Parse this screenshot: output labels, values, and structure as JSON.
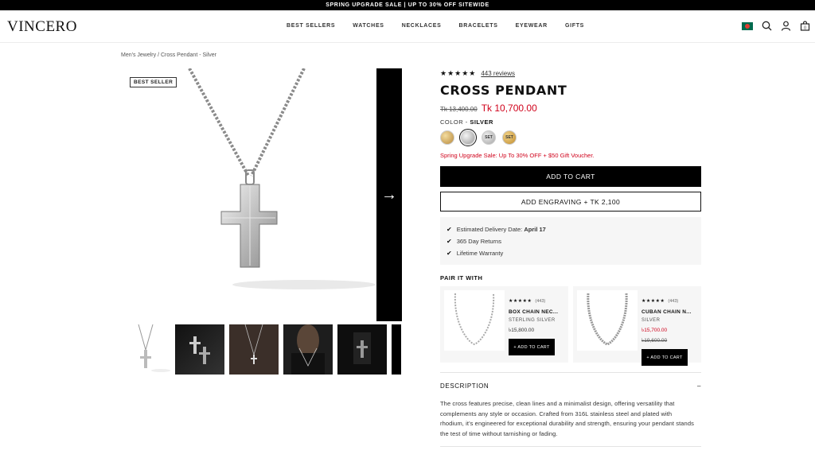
{
  "promo": {
    "text": "SPRING UPGRADE SALE | UP TO 30% OFF SITEWIDE"
  },
  "header": {
    "logo": "VINCERO",
    "nav": [
      "BEST SELLERS",
      "WATCHES",
      "NECKLACES",
      "BRACELETS",
      "EYEWEAR",
      "GIFTS"
    ],
    "icons": [
      "flag-icon",
      "search-icon",
      "account-icon",
      "cart-icon"
    ],
    "cart_count": "0"
  },
  "breadcrumb": "Men's Jewelry / Cross Pendant - Silver",
  "gallery": {
    "badge": "BEST SELLER",
    "next_arrow": "→"
  },
  "product": {
    "stars": "★★★★★",
    "reviews": "443 reviews",
    "title": "CROSS PENDANT",
    "old_price": "Tk 13,400.00",
    "new_price": "Tk 10,700.00",
    "color_label": "COLOR - ",
    "color_value": "SILVER",
    "swatches": [
      "",
      "",
      "SET",
      "SET"
    ],
    "sale_note": "Spring Upgrade Sale: Up To 30% OFF + $50 Gift Voucher.",
    "add_to_cart": "ADD TO CART",
    "engrave": "ADD ENGRAVING + TK 2,100",
    "perks": {
      "delivery_label": "Estimated Delivery Date: ",
      "delivery_date": "April 17",
      "returns": "365 Day Returns",
      "warranty": "Lifetime Warranty"
    }
  },
  "pair": {
    "title": "PAIR IT WITH",
    "items": [
      {
        "stars": "★★★★★",
        "count": "(443)",
        "name": "BOX CHAIN NEC...",
        "variant": "STERLING SILVER",
        "price": "৳15,800.00",
        "old_price": "",
        "button": "+ ADD TO CART"
      },
      {
        "stars": "★★★★★",
        "count": "(443)",
        "name": "CUBAN CHAIN N...",
        "variant": "SILVER",
        "price": "৳15,700.00",
        "old_price": "৳19,600.00",
        "button": "+ ADD TO CART"
      }
    ]
  },
  "description": {
    "heading": "DESCRIPTION",
    "toggle": "–",
    "body": "The cross features precise, clean lines and a minimalist design, offering versatility that complements any style or occasion. Crafted from 316L stainless steel and plated with rhodium, it's engineered for exceptional durability and strength, ensuring your pendant stands the test of time without tarnishing or fading."
  }
}
